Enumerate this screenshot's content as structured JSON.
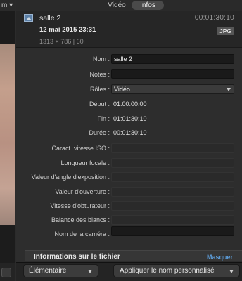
{
  "left_panel": {
    "top_label": "m ▾"
  },
  "tabs": [
    {
      "label": "Vidéo",
      "selected": false
    },
    {
      "label": "Infos",
      "selected": true
    }
  ],
  "clip": {
    "name": "salle 2",
    "date": "12 mai 2015 23:31",
    "format": "1313 × 786  |  60i",
    "duration": "00:01:30:10",
    "type_badge": "JPG"
  },
  "properties": {
    "name": {
      "label": "Nom :",
      "value": "salle 2"
    },
    "notes": {
      "label": "Notes :",
      "value": ""
    },
    "roles": {
      "label": "Rôles :",
      "value": "Vidéo"
    },
    "start": {
      "label": "Début :",
      "value": "01:00:00:00"
    },
    "end": {
      "label": "Fin :",
      "value": "01:01:30:10"
    },
    "duration": {
      "label": "Durée :",
      "value": "00:01:30:10"
    },
    "iso": {
      "label": "Caract. vitesse ISO :",
      "value": ""
    },
    "focal": {
      "label": "Longueur focale :",
      "value": ""
    },
    "exposure_angle": {
      "label": "Valeur d'angle d'exposition :",
      "value": ""
    },
    "aperture": {
      "label": "Valeur d'ouverture :",
      "value": ""
    },
    "shutter": {
      "label": "Vitesse d'obturateur :",
      "value": ""
    },
    "white_balance": {
      "label": "Balance des blancs :",
      "value": ""
    },
    "camera_name": {
      "label": "Nom de la caméra :",
      "value": ""
    }
  },
  "file_info": {
    "title": "Informations sur le fichier",
    "toggle_label": "Masquer"
  },
  "bottom": {
    "preset_label": "Élémentaire",
    "apply_label": "Appliquer le nom personnalisé"
  },
  "colors": {
    "accent_link": "#5b9ad5",
    "panel_bg": "#2d2d2d"
  }
}
